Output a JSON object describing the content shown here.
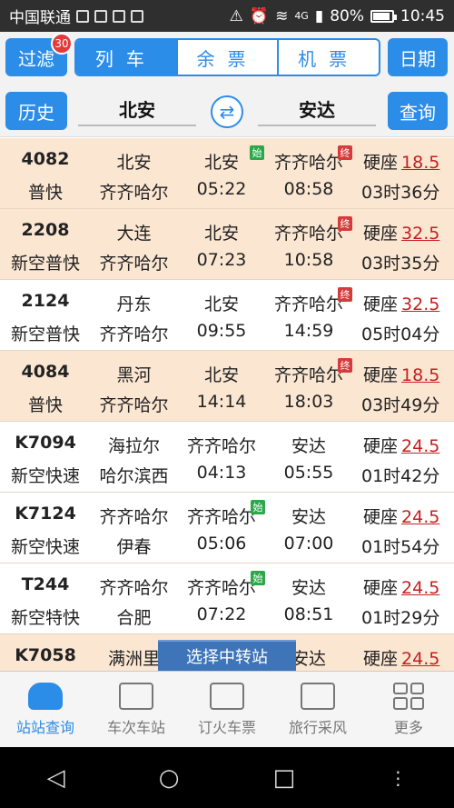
{
  "status_bar": {
    "carrier": "中国联通",
    "network": "4G",
    "battery": "80%",
    "time": "10:45"
  },
  "toolbar": {
    "filter_label": "过滤",
    "filter_badge": "30",
    "tabs": [
      {
        "label": "列车",
        "active": true
      },
      {
        "label": "余票",
        "active": false
      },
      {
        "label": "机票",
        "active": false
      }
    ],
    "date_label": "日期"
  },
  "search": {
    "history_label": "历史",
    "from_station": "北安",
    "to_station": "安达",
    "query_label": "查询"
  },
  "trains": [
    {
      "number": "4082",
      "type": "普快",
      "start": "北安",
      "end": "齐齐哈尔",
      "dep_station": "北安",
      "dep_tag": "始",
      "dep_time": "05:22",
      "arr_station": "齐齐哈尔",
      "arr_tag": "终",
      "arr_time": "08:58",
      "seat": "硬座",
      "price": "18.5",
      "duration": "03时36分"
    },
    {
      "number": "2208",
      "type": "新空普快",
      "start": "大连",
      "end": "齐齐哈尔",
      "dep_station": "北安",
      "dep_tag": "",
      "dep_time": "07:23",
      "arr_station": "齐齐哈尔",
      "arr_tag": "终",
      "arr_time": "10:58",
      "seat": "硬座",
      "price": "32.5",
      "duration": "03时35分"
    },
    {
      "number": "2124",
      "type": "新空普快",
      "start": "丹东",
      "end": "齐齐哈尔",
      "dep_station": "北安",
      "dep_tag": "",
      "dep_time": "09:55",
      "arr_station": "齐齐哈尔",
      "arr_tag": "终",
      "arr_time": "14:59",
      "seat": "硬座",
      "price": "32.5",
      "duration": "05时04分"
    },
    {
      "number": "4084",
      "type": "普快",
      "start": "黑河",
      "end": "齐齐哈尔",
      "dep_station": "北安",
      "dep_tag": "",
      "dep_time": "14:14",
      "arr_station": "齐齐哈尔",
      "arr_tag": "终",
      "arr_time": "18:03",
      "seat": "硬座",
      "price": "18.5",
      "duration": "03时49分"
    },
    {
      "number": "K7094",
      "type": "新空快速",
      "start": "海拉尔",
      "end": "哈尔滨西",
      "dep_station": "齐齐哈尔",
      "dep_tag": "",
      "dep_time": "04:13",
      "arr_station": "安达",
      "arr_tag": "",
      "arr_time": "05:55",
      "seat": "硬座",
      "price": "24.5",
      "duration": "01时42分"
    },
    {
      "number": "K7124",
      "type": "新空快速",
      "start": "齐齐哈尔",
      "end": "伊春",
      "dep_station": "齐齐哈尔",
      "dep_tag": "始",
      "dep_time": "05:06",
      "arr_station": "安达",
      "arr_tag": "",
      "arr_time": "07:00",
      "seat": "硬座",
      "price": "24.5",
      "duration": "01时54分"
    },
    {
      "number": "T244",
      "type": "新空特快",
      "start": "齐齐哈尔",
      "end": "合肥",
      "dep_station": "齐齐哈尔",
      "dep_tag": "始",
      "dep_time": "07:22",
      "arr_station": "安达",
      "arr_tag": "",
      "arr_time": "08:51",
      "seat": "硬座",
      "price": "24.5",
      "duration": "01时29分"
    },
    {
      "number": "K7058",
      "type": "",
      "start": "满洲里",
      "end": "",
      "dep_station": "齐齐哈尔",
      "dep_tag": "",
      "dep_time": "",
      "arr_station": "安达",
      "arr_tag": "",
      "arr_time": "",
      "seat": "硬座",
      "price": "24.5",
      "duration": ""
    }
  ],
  "transfer_popup": "选择中转站",
  "bottom_nav": [
    {
      "label": "站站查询",
      "icon": "train-icon",
      "active": true
    },
    {
      "label": "车次车站",
      "icon": "briefcase-icon",
      "active": false
    },
    {
      "label": "订火车票",
      "icon": "ticket-icon",
      "active": false
    },
    {
      "label": "旅行采风",
      "icon": "chat-icon",
      "active": false
    },
    {
      "label": "更多",
      "icon": "grid-icon",
      "active": false
    }
  ],
  "android_nav": {
    "back": "◁",
    "home": "○",
    "recent": "□",
    "menu": "⋮"
  },
  "colors": {
    "accent": "#2c8de8",
    "row_tint": "#fbe6d2",
    "price": "#c51f1f",
    "start_tag": "#2ca84b",
    "end_tag": "#d63b3b"
  }
}
